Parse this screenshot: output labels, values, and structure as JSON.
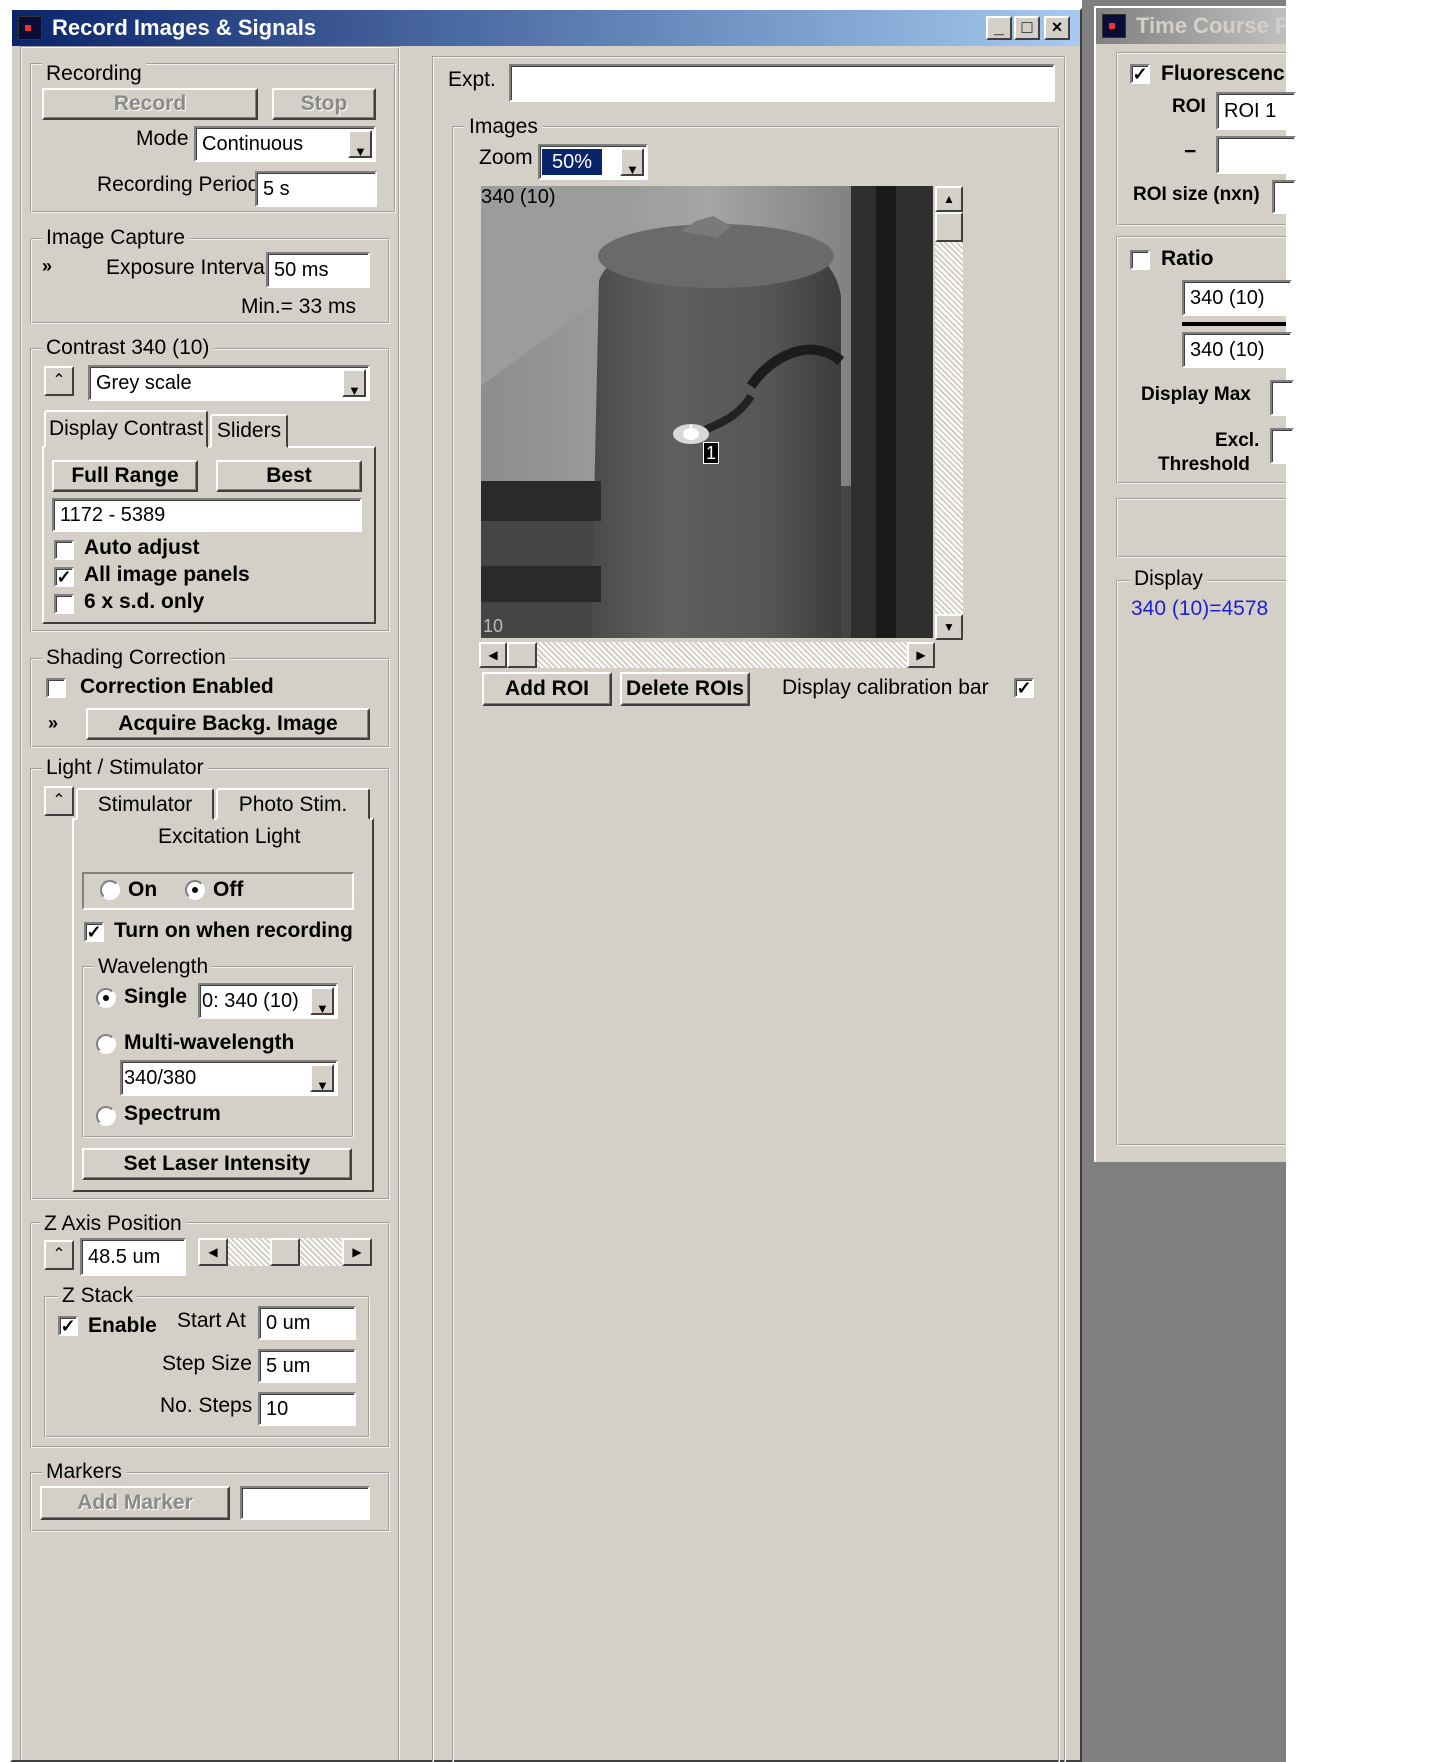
{
  "main_window": {
    "title": "Record Images & Signals",
    "minimize": "_",
    "maximize": "□",
    "close": "×",
    "recording": {
      "group": "Recording",
      "record": "Record",
      "stop": "Stop",
      "mode_label": "Mode",
      "mode_value": "Continuous",
      "period_label": "Recording Period",
      "period_value": "5 s"
    },
    "image_capture": {
      "group": "Image Capture",
      "exposure_label": "Exposure Interval",
      "exposure_value": "50 ms",
      "min_note": "Min.= 33 ms"
    },
    "contrast": {
      "group": "Contrast 340 (10)",
      "palette": "Grey scale",
      "tab_display": "Display Contrast",
      "tab_sliders": "Sliders",
      "full_range": "Full Range",
      "best": "Best",
      "range_value": "1172 - 5389",
      "auto_adjust": "Auto adjust",
      "all_panels": "All image panels",
      "sd_only": "6 x s.d. only"
    },
    "shading": {
      "group": "Shading Correction",
      "enabled": "Correction Enabled",
      "acquire": "Acquire Backg. Image"
    },
    "light": {
      "group": "Light / Stimulator",
      "tab_stimulator": "Stimulator",
      "tab_photostim": "Photo Stim.",
      "excitation": "Excitation Light",
      "on": "On",
      "off": "Off",
      "turn_on": "Turn on when recording",
      "wavelength_group": "Wavelength",
      "single": "Single",
      "single_value": "0: 340 (10)",
      "multi": "Multi-wavelength",
      "multi_value": "340/380",
      "spectrum": "Spectrum",
      "laser": "Set Laser Intensity"
    },
    "zaxis": {
      "group": "Z Axis Position",
      "position": "48.5 um",
      "stack_group": "Z Stack",
      "enable": "Enable",
      "start_label": "Start At",
      "start_value": "0 um",
      "step_label": "Step Size",
      "step_value": "5 um",
      "nsteps_label": "No. Steps",
      "nsteps_value": "10"
    },
    "markers": {
      "group": "Markers",
      "add": "Add Marker",
      "text_value": ""
    },
    "expt": {
      "label": "Expt.",
      "value": ""
    },
    "images": {
      "group": "Images",
      "zoom_label": "Zoom",
      "zoom_value": "50%",
      "frame_label": "340 (10)",
      "roi_marker": "1",
      "scale_label": "10",
      "add_roi": "Add ROI",
      "delete_rois": "Delete ROIs",
      "calib_bar": "Display calibration bar"
    }
  },
  "side_window": {
    "title": "Time Course Pl",
    "fluorescence": "Fluorescenc",
    "roi_label": "ROI",
    "roi_value": "ROI 1",
    "minus": "−",
    "minus_value": "",
    "roi_size_label": "ROI size (nxn)",
    "ratio": "Ratio",
    "num_value": "340 (10)",
    "den_value": "340 (10)",
    "display_max": "Display Max",
    "excl_threshold_1": "Excl.",
    "excl_threshold_2": "Threshold",
    "display_group": "Display",
    "display_readout": "340 (10)=4578"
  },
  "colors": {
    "face": "#d4d0c8",
    "active_title": "#0a246a",
    "readout": "#1f1fd0",
    "desktop": "#808080"
  },
  "icons": [
    "expand-down-icon",
    "collapse-up-icon",
    "crosshair-icon"
  ]
}
